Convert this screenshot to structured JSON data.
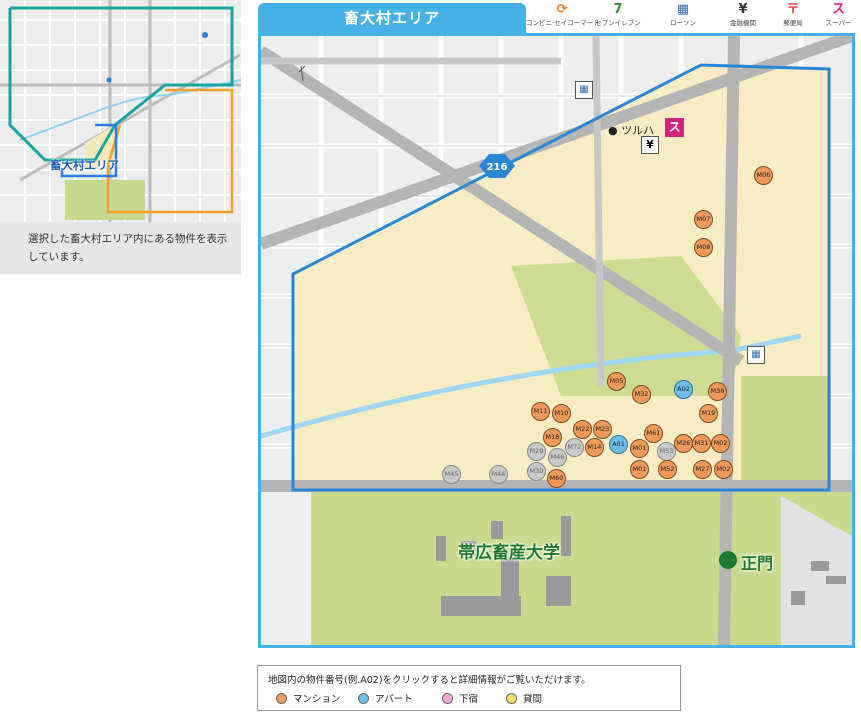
{
  "overview": {
    "area_label": "畜大村エリア",
    "caption": "選択した畜大村エリア内にある物件を表示しています。"
  },
  "map": {
    "title": "畜大村エリア",
    "route_number": "216",
    "store_label": "ツルハ",
    "university_label": "帯広畜産大学",
    "gate_label": "正門"
  },
  "icon_legend": [
    {
      "label": "コンビニ·セイコーマート",
      "icon": "seicomart-icon",
      "glyph": "⟳",
      "color": "#f07a1a"
    },
    {
      "label": "セブンイレブン",
      "icon": "seven-eleven-icon",
      "glyph": "7",
      "color": "#3a8a3a"
    },
    {
      "label": "ローソン",
      "icon": "lawson-icon",
      "glyph": "▦",
      "color": "#2f6db5"
    },
    {
      "label": "金融機関",
      "icon": "bank-icon",
      "glyph": "¥",
      "color": "#333333"
    },
    {
      "label": "郵便局",
      "icon": "post-office-icon",
      "glyph": "〒",
      "color": "#d94a4a"
    },
    {
      "label": "スーパー",
      "icon": "supermarket-icon",
      "glyph": "ス",
      "color": "#d4237a"
    }
  ],
  "markers": [
    {
      "id": "M06",
      "type": "mansion"
    },
    {
      "id": "M07",
      "type": "mansion"
    },
    {
      "id": "M08",
      "type": "mansion"
    },
    {
      "id": "M05",
      "type": "mansion"
    },
    {
      "id": "A02",
      "type": "apart"
    },
    {
      "id": "M38",
      "type": "mansion"
    },
    {
      "id": "M32",
      "type": "mansion"
    },
    {
      "id": "M19",
      "type": "mansion"
    },
    {
      "id": "M11",
      "type": "mansion"
    },
    {
      "id": "M10",
      "type": "mansion"
    },
    {
      "id": "M22",
      "type": "mansion"
    },
    {
      "id": "M23",
      "type": "mansion"
    },
    {
      "id": "M18",
      "type": "mansion"
    },
    {
      "id": "M72",
      "type": "grey"
    },
    {
      "id": "M14",
      "type": "mansion"
    },
    {
      "id": "A01",
      "type": "apart"
    },
    {
      "id": "M61",
      "type": "mansion"
    },
    {
      "id": "M01",
      "type": "mansion"
    },
    {
      "id": "M53",
      "type": "grey"
    },
    {
      "id": "M26",
      "type": "mansion"
    },
    {
      "id": "M31",
      "type": "mansion"
    },
    {
      "id": "M02",
      "type": "mansion"
    },
    {
      "id": "M29",
      "type": "grey"
    },
    {
      "id": "M46",
      "type": "grey"
    },
    {
      "id": "M30",
      "type": "grey"
    },
    {
      "id": "M60",
      "type": "mansion"
    },
    {
      "id": "M01",
      "type": "mansion"
    },
    {
      "id": "M52",
      "type": "mansion"
    },
    {
      "id": "M27",
      "type": "mansion"
    },
    {
      "id": "M02",
      "type": "mansion"
    },
    {
      "id": "M45",
      "type": "grey"
    },
    {
      "id": "M44",
      "type": "grey"
    }
  ],
  "legend": {
    "note": "地図内の物件番号(例.A02)をクリックすると詳細情報がご覧いただけます。",
    "items": [
      {
        "label": "マンション",
        "color": "#f09a5a"
      },
      {
        "label": "アパート",
        "color": "#6cbde8"
      },
      {
        "label": "下宿",
        "color": "#f7a8d4"
      },
      {
        "label": "貸間",
        "color": "#f5e06a"
      }
    ]
  }
}
